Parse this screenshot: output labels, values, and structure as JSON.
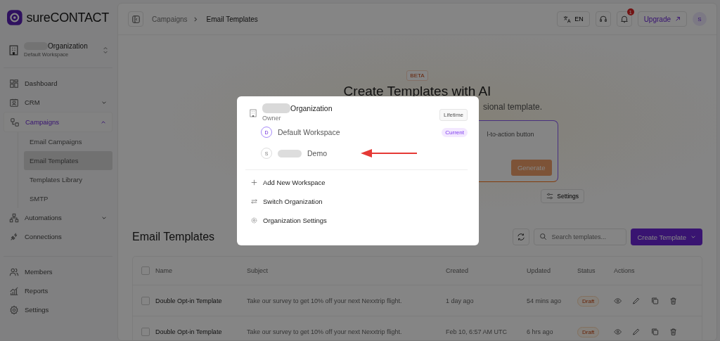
{
  "brand": {
    "prefix": "sure",
    "name": "CONTACT"
  },
  "org_switcher": {
    "name": "Organization",
    "workspace": "Default Workspace"
  },
  "nav": [
    {
      "label": "Dashboard",
      "kind": "link",
      "selected": false
    },
    {
      "label": "CRM",
      "kind": "group",
      "selected": false,
      "expanded": false
    },
    {
      "label": "Campaigns",
      "kind": "group",
      "selected": true,
      "expanded": true,
      "children": [
        {
          "label": "Email Campaigns",
          "selected": false
        },
        {
          "label": "Email Templates",
          "selected": true
        },
        {
          "label": "Templates Library",
          "selected": false
        },
        {
          "label": "SMTP",
          "selected": false
        }
      ]
    },
    {
      "label": "Automations",
      "kind": "group",
      "selected": false,
      "expanded": false
    },
    {
      "label": "Connections",
      "kind": "link",
      "selected": false
    }
  ],
  "nav_bottom": [
    {
      "label": "Members",
      "selected": false
    },
    {
      "label": "Reports",
      "selected": false
    },
    {
      "label": "Settings",
      "selected": false
    }
  ],
  "topbar": {
    "breadcrumbs": [
      "Campaigns",
      "Email Templates"
    ],
    "language": "EN",
    "notification_count": "1",
    "upgrade": "Upgrade",
    "avatar": "S"
  },
  "hero": {
    "badge": "BETA",
    "title": "Create Templates with AI",
    "subtitle": "sional template.",
    "prompt_placeholder": "l-to-action button",
    "generate": "Generate",
    "settings": "Settings"
  },
  "templates": {
    "title": "Email Templates",
    "search_placeholder": "Search templates...",
    "create": "Create Template",
    "select_all_checked": false,
    "columns": [
      "Name",
      "Subject",
      "Created",
      "Updated",
      "Status",
      "Actions"
    ],
    "rows": [
      {
        "name": "Double Opt-in Template",
        "subject": "Take our survey to get 10% off your next Nexxtrip flight.",
        "created": "1 day ago",
        "updated": "54 mins ago",
        "status": "Draft",
        "checked": false
      },
      {
        "name": "Double Opt-in Template",
        "subject": "Take our survey to get 10% off your next Nexxtrip flight.",
        "created": "Feb 10, 6:57 AM UTC",
        "updated": "6 hrs ago",
        "status": "Draft",
        "checked": false
      }
    ]
  },
  "popup": {
    "org": {
      "name": "Organization",
      "role": "Owner",
      "plan": "Lifetime"
    },
    "workspaces": [
      {
        "initial": "D",
        "name": "Default Workspace",
        "badge": "Current",
        "selected": true
      },
      {
        "initial": "S",
        "name": "Demo",
        "selected": false
      }
    ],
    "actions": [
      "Add New Workspace",
      "Switch Organization",
      "Organization Settings"
    ]
  }
}
